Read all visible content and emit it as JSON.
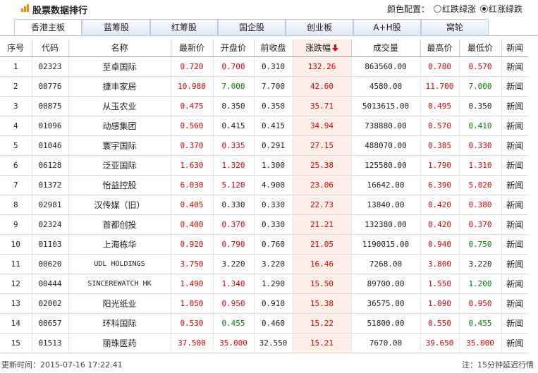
{
  "header": {
    "title": "股票数据排行",
    "color_config_label": "颜色配置：",
    "option_red_down": "红跌绿涨",
    "option_red_up": "红涨绿跌",
    "selected": "红涨绿跌"
  },
  "tabs": [
    "香港主板",
    "蓝筹股",
    "红筹股",
    "国企股",
    "创业板",
    "A+H股",
    "窝轮"
  ],
  "active_tab": "香港主板",
  "columns": [
    "序号",
    "代码",
    "名称",
    "最新价",
    "开盘价",
    "前收盘",
    "涨跌幅",
    "成交量",
    "最高价",
    "最低价",
    "新闻"
  ],
  "sort_icon": "sort-desc-arrow-icon",
  "colors": {
    "up": "#e60000",
    "down": "#008000",
    "highlight_column": "#fdeee7",
    "accent": "#f18b00"
  },
  "rows": [
    {
      "no": "1",
      "code": "02323",
      "name": "至卓国际",
      "latest": "0.720",
      "open": "0.700",
      "prev": "0.310",
      "pct": "132.26",
      "volume": "863560.00",
      "high": "0.780",
      "low": "0.570",
      "news": "新闻",
      "latest_c": "up",
      "open_c": "up",
      "high_c": "up",
      "low_c": "up"
    },
    {
      "no": "2",
      "code": "00776",
      "name": "捷丰家居",
      "latest": "10.980",
      "open": "7.000",
      "prev": "7.700",
      "pct": "42.60",
      "volume": "4580.00",
      "high": "11.700",
      "low": "7.000",
      "news": "新闻",
      "latest_c": "up",
      "open_c": "dn",
      "high_c": "up",
      "low_c": "dn"
    },
    {
      "no": "3",
      "code": "00875",
      "name": "从玉农业",
      "latest": "0.475",
      "open": "0.350",
      "prev": "0.350",
      "pct": "35.71",
      "volume": "5013615.00",
      "high": "0.495",
      "low": "0.350",
      "news": "新闻",
      "latest_c": "up",
      "open_c": "",
      "high_c": "up",
      "low_c": ""
    },
    {
      "no": "4",
      "code": "01096",
      "name": "动感集团",
      "latest": "0.560",
      "open": "0.415",
      "prev": "0.415",
      "pct": "34.94",
      "volume": "738880.00",
      "high": "0.570",
      "low": "0.410",
      "news": "新闻",
      "latest_c": "up",
      "open_c": "",
      "high_c": "up",
      "low_c": "dn"
    },
    {
      "no": "5",
      "code": "01046",
      "name": "寰宇国际",
      "latest": "0.370",
      "open": "0.335",
      "prev": "0.291",
      "pct": "27.15",
      "volume": "488070.00",
      "high": "0.385",
      "low": "0.330",
      "news": "新闻",
      "latest_c": "up",
      "open_c": "up",
      "high_c": "up",
      "low_c": "up"
    },
    {
      "no": "6",
      "code": "06128",
      "name": "泛亚国际",
      "latest": "1.630",
      "open": "1.320",
      "prev": "1.300",
      "pct": "25.38",
      "volume": "125580.00",
      "high": "1.790",
      "low": "1.310",
      "news": "新闻",
      "latest_c": "up",
      "open_c": "up",
      "high_c": "up",
      "low_c": "up"
    },
    {
      "no": "7",
      "code": "01372",
      "name": "怡益控股",
      "latest": "6.030",
      "open": "5.120",
      "prev": "4.900",
      "pct": "23.06",
      "volume": "16642.00",
      "high": "6.390",
      "low": "5.020",
      "news": "新闻",
      "latest_c": "up",
      "open_c": "up",
      "high_c": "up",
      "low_c": "up"
    },
    {
      "no": "8",
      "code": "02981",
      "name": "汉传媒（旧）",
      "latest": "0.405",
      "open": "0.330",
      "prev": "0.330",
      "pct": "22.73",
      "volume": "13840.00",
      "high": "0.420",
      "low": "0.380",
      "news": "新闻",
      "latest_c": "up",
      "open_c": "",
      "high_c": "up",
      "low_c": "up"
    },
    {
      "no": "9",
      "code": "02324",
      "name": "首都创投",
      "latest": "0.400",
      "open": "0.370",
      "prev": "0.330",
      "pct": "21.21",
      "volume": "132380.00",
      "high": "0.420",
      "low": "0.370",
      "news": "新闻",
      "latest_c": "up",
      "open_c": "up",
      "high_c": "up",
      "low_c": "up"
    },
    {
      "no": "10",
      "code": "01103",
      "name": "上海栋华",
      "latest": "0.920",
      "open": "0.790",
      "prev": "0.760",
      "pct": "21.05",
      "volume": "1190015.00",
      "high": "0.940",
      "low": "0.750",
      "news": "新闻",
      "latest_c": "up",
      "open_c": "up",
      "high_c": "up",
      "low_c": "dn"
    },
    {
      "no": "11",
      "code": "00620",
      "name": "UDL HOLDINGS",
      "latest": "3.750",
      "open": "3.220",
      "prev": "3.220",
      "pct": "16.46",
      "volume": "7268.00",
      "high": "3.800",
      "low": "3.220",
      "news": "新闻",
      "latest_c": "up",
      "open_c": "",
      "high_c": "up",
      "low_c": "",
      "latin": true
    },
    {
      "no": "12",
      "code": "00444",
      "name": "SINCEREWATCH HK",
      "latest": "1.490",
      "open": "1.340",
      "prev": "1.290",
      "pct": "15.50",
      "volume": "89700.00",
      "high": "1.550",
      "low": "1.200",
      "news": "新闻",
      "latest_c": "up",
      "open_c": "up",
      "high_c": "up",
      "low_c": "dn",
      "latin": true
    },
    {
      "no": "13",
      "code": "02002",
      "name": "阳光纸业",
      "latest": "1.050",
      "open": "0.950",
      "prev": "0.910",
      "pct": "15.38",
      "volume": "36575.00",
      "high": "1.090",
      "low": "0.950",
      "news": "新闻",
      "latest_c": "up",
      "open_c": "up",
      "high_c": "up",
      "low_c": "up"
    },
    {
      "no": "14",
      "code": "00657",
      "name": "环科国际",
      "latest": "0.530",
      "open": "0.455",
      "prev": "0.460",
      "pct": "15.22",
      "volume": "51800.00",
      "high": "0.550",
      "low": "0.455",
      "news": "新闻",
      "latest_c": "up",
      "open_c": "dn",
      "high_c": "up",
      "low_c": "dn"
    },
    {
      "no": "15",
      "code": "01513",
      "name": "丽珠医药",
      "latest": "37.500",
      "open": "35.000",
      "prev": "32.550",
      "pct": "15.21",
      "volume": "7670.00",
      "high": "39.650",
      "low": "35.000",
      "news": "新闻",
      "latest_c": "up",
      "open_c": "up",
      "high_c": "up",
      "low_c": "up"
    }
  ],
  "footer": {
    "updated_label": "更新时间：",
    "updated_time": "2015-07-16 17:22.41",
    "note": "注：15分钟延迟行情"
  }
}
